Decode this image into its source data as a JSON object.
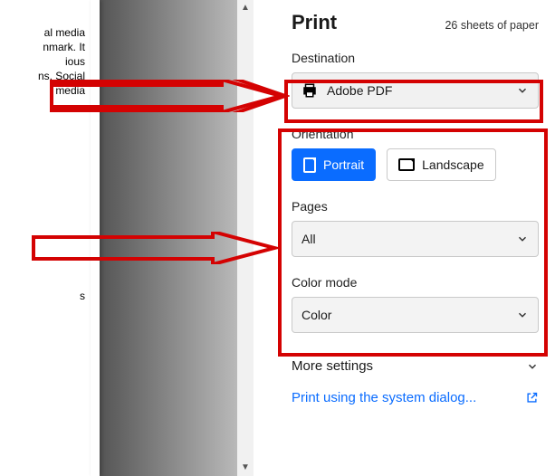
{
  "header": {
    "title": "Print",
    "sheets_text": "26 sheets of paper"
  },
  "destination": {
    "label": "Destination",
    "value": "Adobe PDF"
  },
  "orientation": {
    "label": "Orientation",
    "portrait_label": "Portrait",
    "landscape_label": "Landscape",
    "active": "portrait"
  },
  "pages": {
    "label": "Pages",
    "value": "All"
  },
  "color_mode": {
    "label": "Color mode",
    "value": "Color"
  },
  "more_settings_label": "More settings",
  "system_dialog_label": "Print using the system dialog...",
  "doc_fragment": {
    "lines": "al media\nnmark. It\nious\nns, Social\nmedia",
    "lower": "s"
  },
  "annotation_color": "#d40202"
}
